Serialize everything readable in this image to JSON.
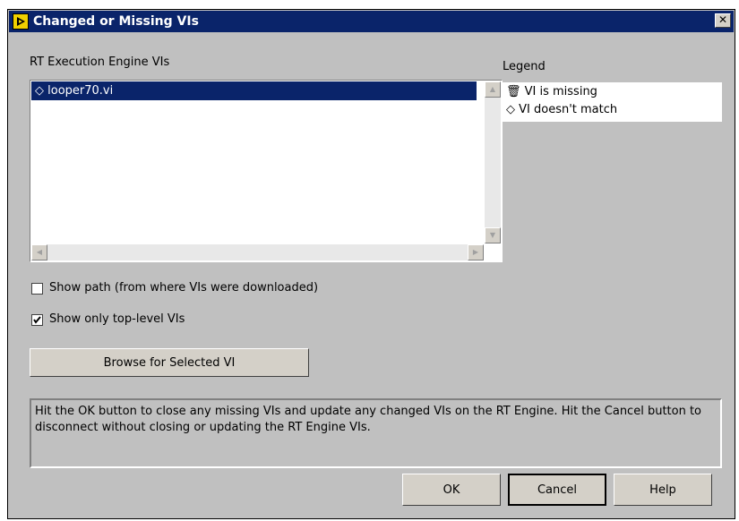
{
  "window": {
    "title": "Changed or Missing VIs",
    "close_glyph": "✕"
  },
  "list": {
    "label": "RT Execution Engine VIs",
    "items": [
      {
        "text": "◇ looper70.vi",
        "selected": true
      }
    ]
  },
  "legend": {
    "label": "Legend",
    "items": [
      {
        "text": "🗑 VI is missing",
        "icon": "trash-icon"
      },
      {
        "text": "◇ VI doesn't match",
        "icon": "diamond-icon"
      }
    ]
  },
  "options": {
    "show_path": {
      "label": "Show path (from where VIs were downloaded)",
      "checked": false
    },
    "show_top_level": {
      "label": "Show only top-level VIs",
      "checked": true
    }
  },
  "browse_button": "Browse for Selected VI",
  "message": "Hit the OK button to close any missing VIs and update any changed VIs on the RT Engine. Hit the Cancel button to disconnect without closing or updating the RT Engine VIs.",
  "buttons": {
    "ok": "OK",
    "cancel": "Cancel",
    "help": "Help"
  },
  "colors": {
    "title_bar": "#0a246a",
    "dialog_bg": "#c0c0c0",
    "selection": "#0a246a"
  }
}
